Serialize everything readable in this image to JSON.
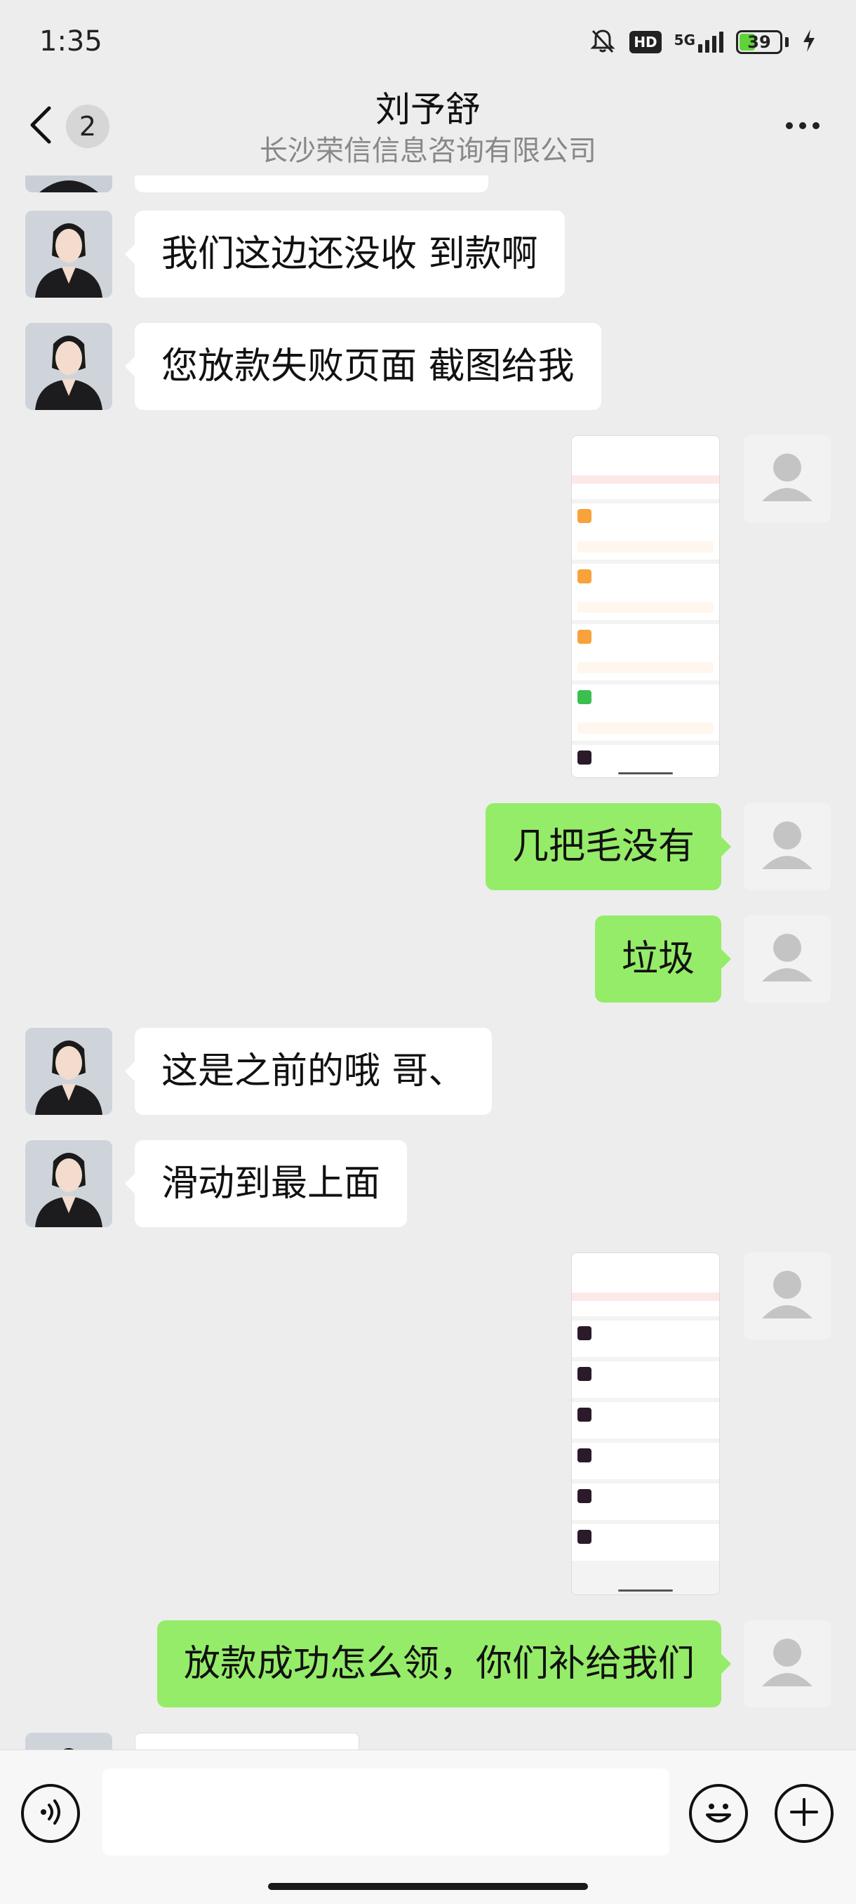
{
  "status_bar": {
    "time": "1:35",
    "hd": "HD",
    "network": "5G",
    "battery": "39",
    "battery_level": 0.39
  },
  "header": {
    "back_badge": "2",
    "title": "刘予舒",
    "subtitle": "长沙荣信信息咨询有限公司"
  },
  "messages": {
    "m1": "我们这边还没收 到款啊",
    "m2": "您放款失败页面 截图给我",
    "m3": "几把毛没有",
    "m4": "垃圾",
    "m5": "这是之前的哦 哥、",
    "m6": "滑动到最上面",
    "m7": "放款成功怎么领，你们补给我们"
  },
  "input": {
    "placeholder": ""
  },
  "colors": {
    "outgoing_bubble": "#95ec69",
    "incoming_bubble": "#ffffff",
    "background": "#ededed"
  },
  "icons": {
    "back": "chevron-left-icon",
    "more": "more-dots-icon",
    "voice": "voice-icon",
    "emoji": "emoji-icon",
    "plus": "plus-icon",
    "mute": "bell-off-icon",
    "charging": "bolt-icon"
  }
}
